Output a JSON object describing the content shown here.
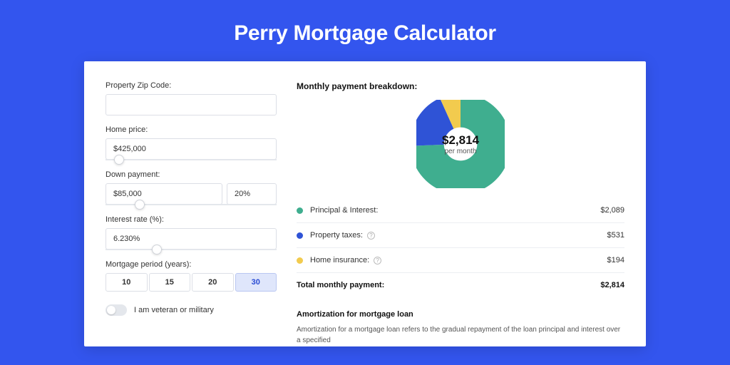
{
  "title": "Perry Mortgage Calculator",
  "colors": {
    "pi": "#3fae8f",
    "taxes": "#2f53d6",
    "insurance": "#f2cb4e"
  },
  "form": {
    "zip": {
      "label": "Property Zip Code:",
      "value": ""
    },
    "home_price": {
      "label": "Home price:",
      "value": "$425,000",
      "slider_pct": 8
    },
    "down_payment": {
      "label": "Down payment:",
      "amount": "$85,000",
      "pct": "20%",
      "slider_pct": 20
    },
    "interest_rate": {
      "label": "Interest rate (%):",
      "value": "6.230%",
      "slider_pct": 30
    },
    "period": {
      "label": "Mortgage period (years):",
      "options": [
        "10",
        "15",
        "20",
        "30"
      ],
      "selected": "30"
    },
    "veteran": {
      "label": "I am veteran or military",
      "value": false
    }
  },
  "breakdown": {
    "title": "Monthly payment breakdown:",
    "total_display": "$2,814",
    "total_sub": "per month",
    "items": [
      {
        "key": "pi",
        "label": "Principal & Interest:",
        "value_display": "$2,089",
        "value": 2089,
        "has_info": false
      },
      {
        "key": "taxes",
        "label": "Property taxes:",
        "value_display": "$531",
        "value": 531,
        "has_info": true
      },
      {
        "key": "insurance",
        "label": "Home insurance:",
        "value_display": "$194",
        "value": 194,
        "has_info": true
      }
    ],
    "total_label": "Total monthly payment:",
    "total_value": "$2,814"
  },
  "chart_data": {
    "type": "pie",
    "title": "Monthly payment breakdown",
    "slices": [
      {
        "name": "Principal & Interest",
        "value": 2089,
        "color": "#3fae8f"
      },
      {
        "name": "Property taxes",
        "value": 531,
        "color": "#2f53d6"
      },
      {
        "name": "Home insurance",
        "value": 194,
        "color": "#f2cb4e"
      }
    ],
    "total": 2814,
    "center_label": "$2,814",
    "center_sub": "per month"
  },
  "amortization": {
    "title": "Amortization for mortgage loan",
    "body": "Amortization for a mortgage loan refers to the gradual repayment of the loan principal and interest over a specified"
  }
}
